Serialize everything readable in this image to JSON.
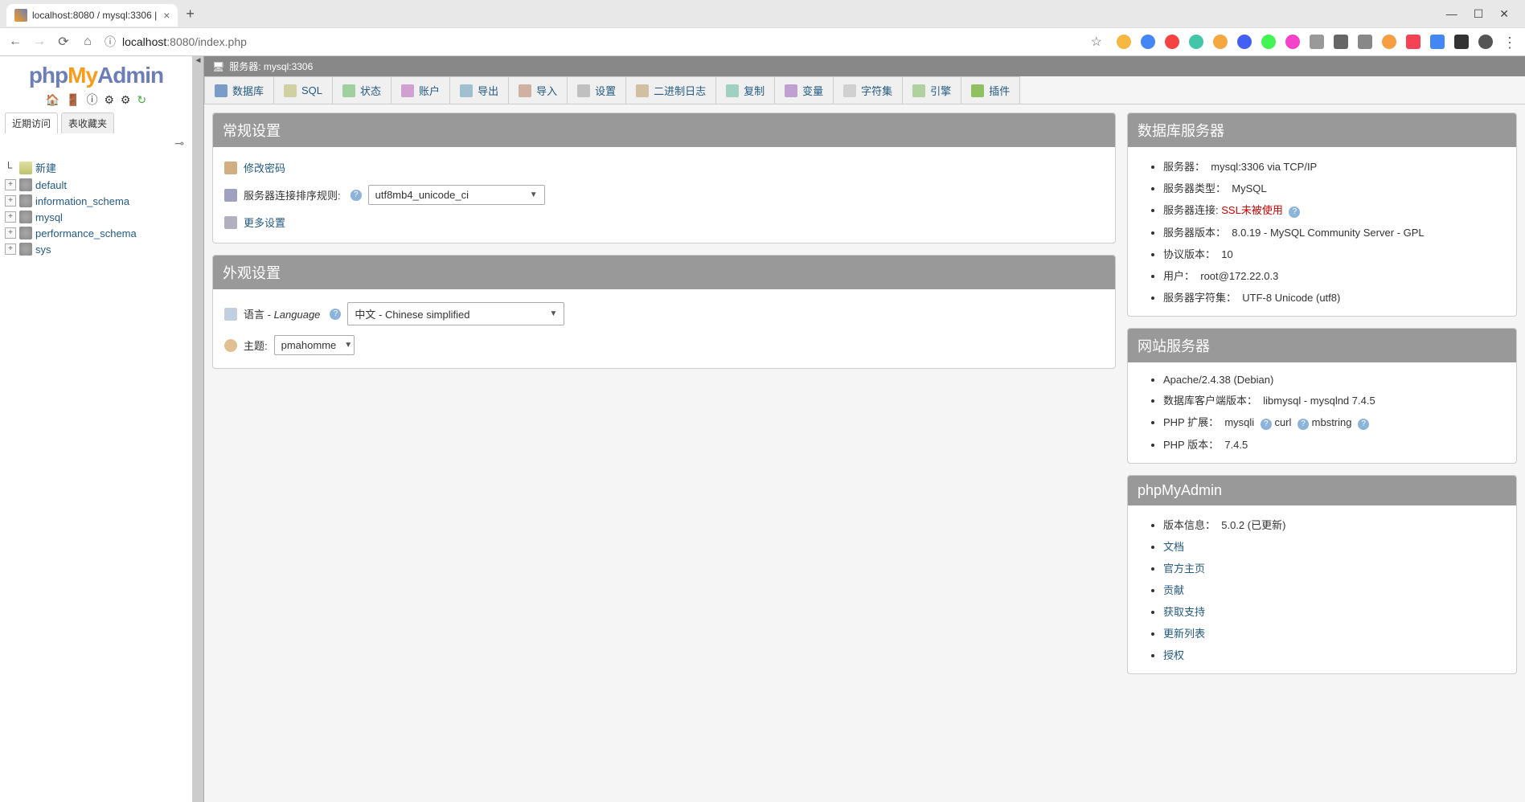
{
  "browser": {
    "tab_title": "localhost:8080 / mysql:3306 | ",
    "url_host": "localhost",
    "url_port_path": ":8080/index.php"
  },
  "sidebar": {
    "logo_php": "php",
    "logo_my": "My",
    "logo_admin": "Admin",
    "tabs": {
      "recent": "近期访问",
      "favorites": "表收藏夹"
    },
    "new_label": "新建",
    "dbs": [
      "default",
      "information_schema",
      "mysql",
      "performance_schema",
      "sys"
    ]
  },
  "server_bar": {
    "label": "服务器: mysql:3306"
  },
  "top_tabs": {
    "db": "数据库",
    "sql": "SQL",
    "status": "状态",
    "users": "账户",
    "export": "导出",
    "import": "导入",
    "settings": "设置",
    "binlog": "二进制日志",
    "repl": "复制",
    "vars": "变量",
    "charset": "字符集",
    "engine": "引擎",
    "plugin": "插件"
  },
  "general": {
    "title": "常规设置",
    "change_password": "修改密码",
    "collation_label": "服务器连接排序规则:",
    "collation_value": "utf8mb4_unicode_ci",
    "more_settings": "更多设置"
  },
  "appearance": {
    "title": "外观设置",
    "lang_label": "语言 - ",
    "lang_label_en": "Language",
    "lang_value": "中文 - Chinese simplified",
    "theme_label": "主题:",
    "theme_value": "pmahomme"
  },
  "db_server": {
    "title": "数据库服务器",
    "server_label": "服务器：",
    "server_value": "mysql:3306 via TCP/IP",
    "type_label": "服务器类型：",
    "type_value": "MySQL",
    "conn_label": "服务器连接:",
    "conn_value": "SSL未被使用",
    "version_label": "服务器版本：",
    "version_value": "8.0.19 - MySQL Community Server - GPL",
    "proto_label": "协议版本：",
    "proto_value": "10",
    "user_label": "用户：",
    "user_value": "root@172.22.0.3",
    "charset_label": "服务器字符集：",
    "charset_value": "UTF-8 Unicode (utf8)"
  },
  "web_server": {
    "title": "网站服务器",
    "apache": "Apache/2.4.38 (Debian)",
    "client_label": "数据库客户端版本：",
    "client_value": "libmysql - mysqlnd 7.4.5",
    "phpext_label": "PHP 扩展：",
    "phpext_v1": "mysqli",
    "phpext_v2": "curl",
    "phpext_v3": "mbstring",
    "phpver_label": "PHP 版本：",
    "phpver_value": "7.4.5"
  },
  "pma": {
    "title": "phpMyAdmin",
    "version_label": "版本信息：",
    "version_value": "5.0.2 (已更新)",
    "links": [
      "文档",
      "官方主页",
      "贡献",
      "获取支持",
      "更新列表",
      "授权"
    ]
  }
}
